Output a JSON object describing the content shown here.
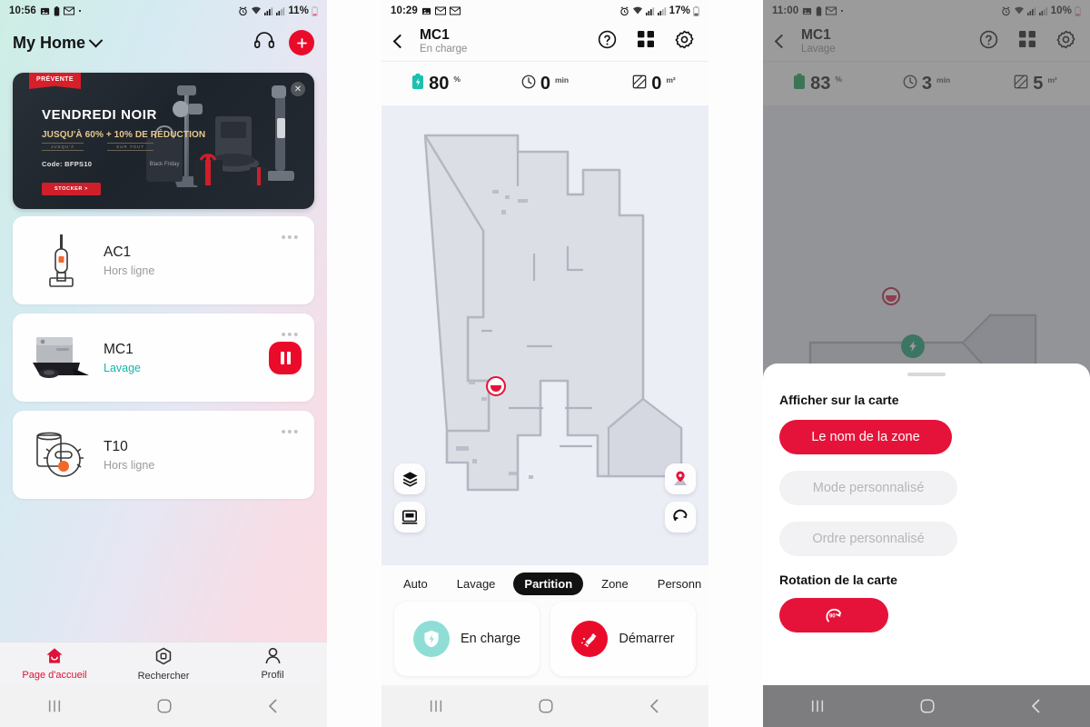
{
  "panel1": {
    "status_bar": {
      "time": "10:56",
      "battery": "11%",
      "icons": [
        "image-icon",
        "battery-icon",
        "gmail-icon",
        "dot-icon"
      ],
      "right_icons": [
        "alarm-icon",
        "wifi-icon",
        "signal-icon",
        "signal-icon"
      ]
    },
    "header": {
      "title": "My Home",
      "chevron": "chevron-down-icon",
      "headset_icon": "headset-icon",
      "add_icon": "plus-icon"
    },
    "banner": {
      "ribbon": "PRÉVENTE",
      "title": "VENDREDI NOIR",
      "offer": "JUSQU'À 60% + 10% DE RÉDUCTION",
      "sub_left": "JUSQU'À",
      "sub_right": "SUR TOUT",
      "code": "Code: BFPS10",
      "cta": "STOCKER >",
      "close": "close-icon"
    },
    "devices": [
      {
        "name": "AC1",
        "status": "Hors ligne",
        "status_active": false,
        "icon": "stick-vacuum-icon",
        "has_pause": false
      },
      {
        "name": "MC1",
        "status": "Lavage",
        "status_active": true,
        "icon": "robot-vacuum-dock-icon",
        "has_pause": true
      },
      {
        "name": "T10",
        "status": "Hors ligne",
        "status_active": false,
        "icon": "robot-vacuum-icon",
        "has_pause": false
      }
    ],
    "bottom_nav": [
      {
        "label": "Page d'accueil",
        "icon": "home-icon",
        "active": true
      },
      {
        "label": "Rechercher",
        "icon": "explore-icon",
        "active": false
      },
      {
        "label": "Profil",
        "icon": "person-icon",
        "active": false
      }
    ]
  },
  "panel2": {
    "status_bar": {
      "time": "10:29",
      "battery": "17%"
    },
    "header": {
      "back": "back-arrow-icon",
      "device_name": "MC1",
      "device_state": "En charge",
      "help_icon": "help-circle-icon",
      "grid_icon": "grid-icon",
      "settings_icon": "gear-icon"
    },
    "stats": [
      {
        "icon": "battery-charging-icon",
        "value": "80",
        "unit": "%"
      },
      {
        "icon": "clock-icon",
        "value": "0",
        "unit": "min"
      },
      {
        "icon": "area-icon",
        "value": "0",
        "unit": "m²"
      }
    ],
    "map_controls": [
      {
        "name": "layers-icon",
        "pos": "left-top"
      },
      {
        "name": "map-card-icon",
        "pos": "left-bottom"
      },
      {
        "name": "map-pin-icon",
        "pos": "right-top"
      },
      {
        "name": "rotate-icon",
        "pos": "right-bottom"
      }
    ],
    "map_markers": [
      {
        "type": "robot-marker",
        "color": "#e5133a"
      }
    ],
    "modes": [
      {
        "label": "Auto",
        "selected": false
      },
      {
        "label": "Lavage",
        "selected": false
      },
      {
        "label": "Partition",
        "selected": true
      },
      {
        "label": "Zone",
        "selected": false
      },
      {
        "label": "Personn",
        "selected": false
      }
    ],
    "actions": [
      {
        "label": "En charge",
        "icon": "charge-plug-icon",
        "color": "#8fded5"
      },
      {
        "label": "Démarrer",
        "icon": "clean-start-icon",
        "color": "#ea0b2a"
      }
    ]
  },
  "panel3": {
    "status_bar": {
      "time": "11:00",
      "battery": "10%"
    },
    "header": {
      "back": "back-arrow-icon",
      "device_name": "MC1",
      "device_state": "Lavage",
      "help_icon": "help-circle-icon",
      "grid_icon": "grid-icon",
      "settings_icon": "gear-icon"
    },
    "stats": [
      {
        "icon": "battery-icon",
        "value": "83",
        "unit": "%"
      },
      {
        "icon": "clock-icon",
        "value": "3",
        "unit": "min"
      },
      {
        "icon": "area-icon",
        "value": "5",
        "unit": "m²"
      }
    ],
    "map_markers": [
      {
        "type": "robot-marker",
        "color": "#b01436"
      },
      {
        "type": "dock-marker",
        "color": "#0f9d6e"
      }
    ],
    "sheet": {
      "section1_title": "Afficher sur la carte",
      "options": [
        {
          "label": "Le nom de la zone",
          "enabled": true
        },
        {
          "label": "Mode personnalisé",
          "enabled": false
        },
        {
          "label": "Ordre personnalisé",
          "enabled": false
        }
      ],
      "section2_title": "Rotation de la carte",
      "rotate_button": {
        "icon": "rotate-90-icon",
        "label": ""
      }
    }
  },
  "android_nav": {
    "recent": "recents-icon",
    "home": "home-square-icon",
    "back": "back-chevron-icon"
  },
  "colors": {
    "accent_red": "#e5133a",
    "accent_teal": "#17b6a8",
    "dock_green": "#0f9d6e",
    "dark": "#121212"
  }
}
